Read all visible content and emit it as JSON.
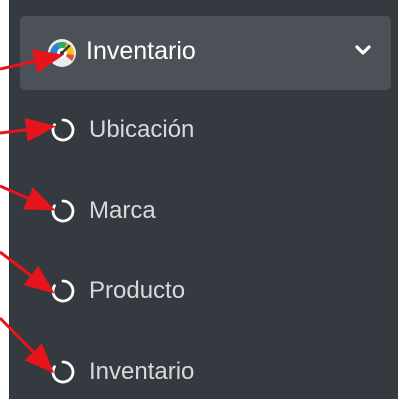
{
  "sidebar": {
    "menu": {
      "label": "Inventario",
      "icon": "dashboard-gauge-icon",
      "expanded": true,
      "chevron_icon": "chevron-down-icon"
    },
    "subitems": [
      {
        "label": "Ubicación",
        "icon": "circle-outline-icon"
      },
      {
        "label": "Marca",
        "icon": "circle-outline-icon"
      },
      {
        "label": "Producto",
        "icon": "circle-outline-icon"
      },
      {
        "label": "Inventario",
        "icon": "circle-outline-icon"
      }
    ]
  },
  "colors": {
    "sidebar_bg": "#343a40",
    "active_item_bg": "#4b5157",
    "text_primary": "#ffffff",
    "text_secondary": "#d7dadd",
    "annotation_arrow": "#e8141c"
  }
}
